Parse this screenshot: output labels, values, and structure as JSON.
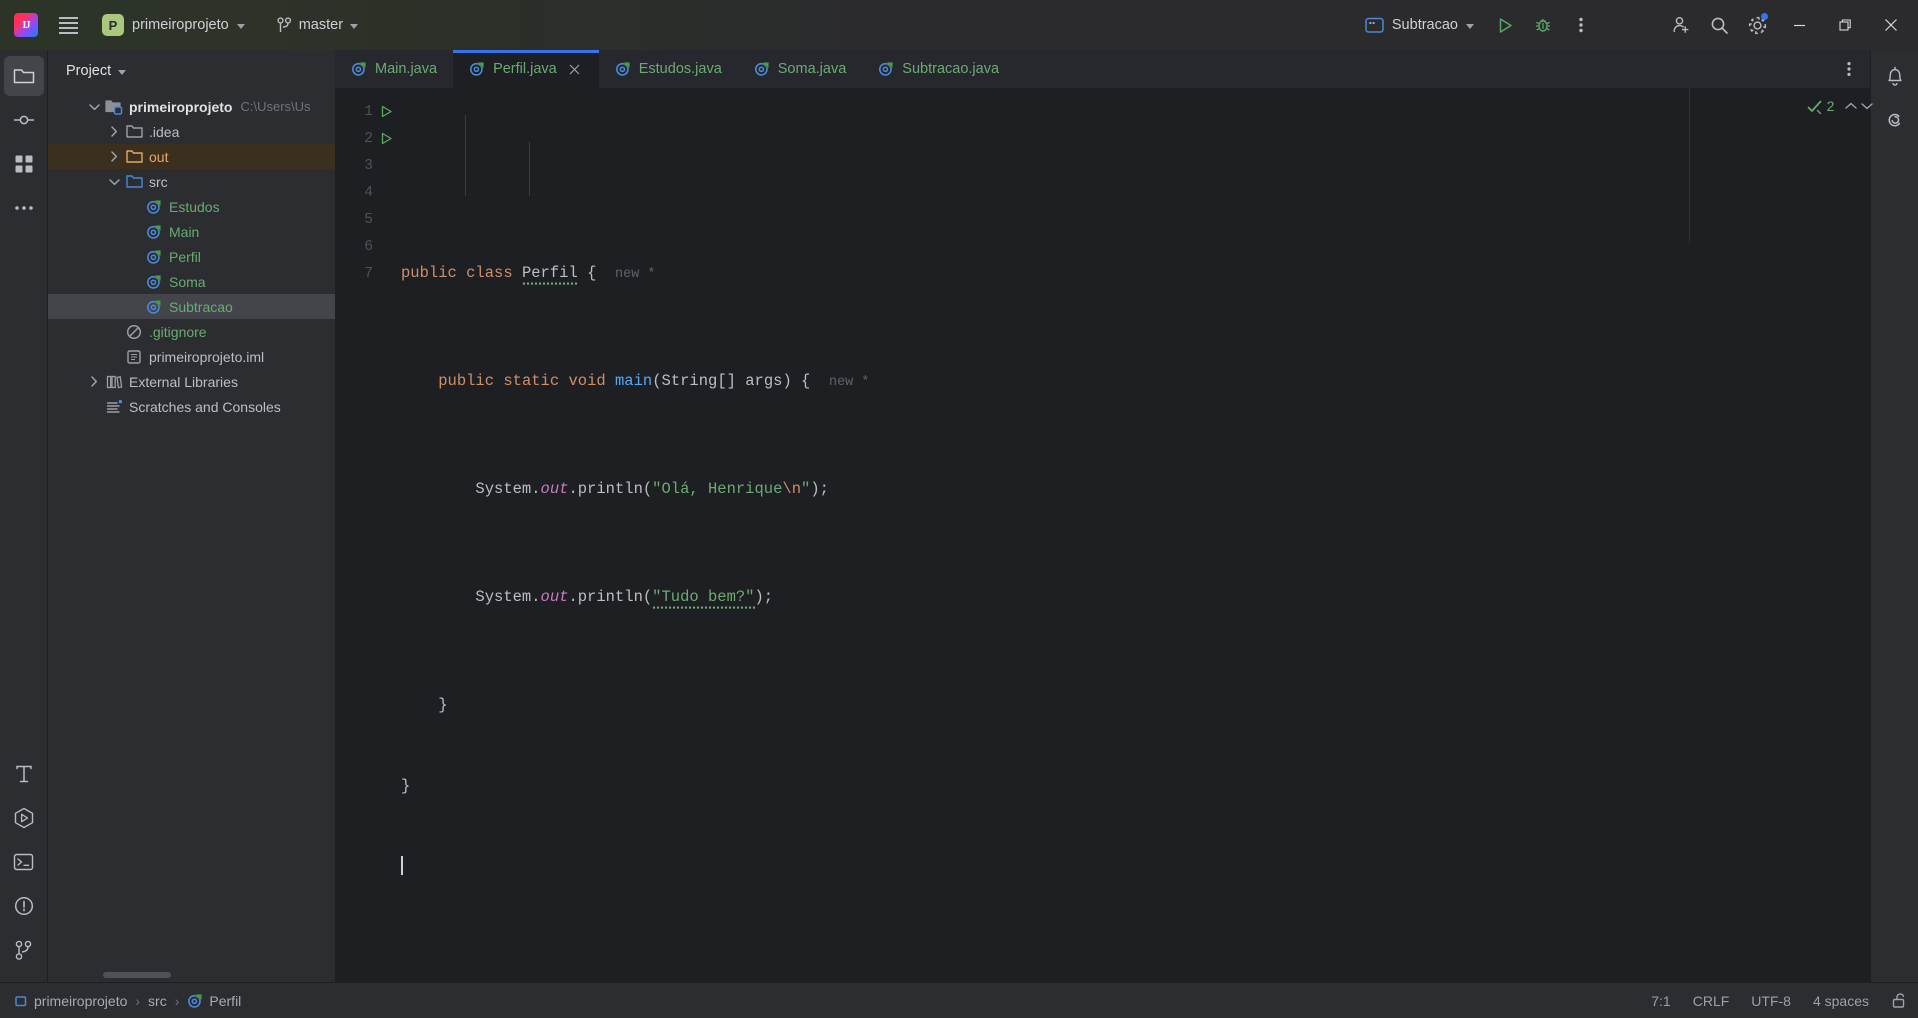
{
  "titlebar": {
    "logo_icon": "intellij-idea-logo",
    "logo_text": "IJ",
    "menu_icon": "hamburger-menu-icon",
    "project_badge": "P",
    "project_name": "primeiroprojeto",
    "vcs_icon": "git-branch-icon",
    "vcs_branch": "master",
    "run_config_icon": "run-configuration-icon",
    "run_config_name": "Subtracao",
    "run_icon": "run-play-icon",
    "debug_icon": "debug-bug-icon",
    "more_icon": "more-vertical-icon",
    "account_icon": "add-user-icon",
    "search_icon": "search-icon",
    "settings_icon": "gear-icon",
    "minimize_icon": "minimize-icon",
    "maximize_icon": "maximize-restore-icon",
    "close_icon": "close-icon"
  },
  "left_stripe": {
    "top_items": [
      {
        "name": "project-tool-window",
        "icon": "folder-icon",
        "active": true
      },
      {
        "name": "commit-tool-window",
        "icon": "commit-icon",
        "active": false
      },
      {
        "name": "structure-tool-window",
        "icon": "structure-icon",
        "active": false
      },
      {
        "name": "more-tool-windows",
        "icon": "more-horizontal-icon",
        "active": false
      }
    ],
    "bottom_items": [
      {
        "name": "ai-assistant-tool-window",
        "icon": "text-tool-icon"
      },
      {
        "name": "services-tool-window",
        "icon": "run-services-icon"
      },
      {
        "name": "terminal-tool-window",
        "icon": "terminal-icon"
      },
      {
        "name": "problems-tool-window",
        "icon": "problems-icon"
      },
      {
        "name": "version-control-tool-window",
        "icon": "git-icon"
      }
    ]
  },
  "right_stripe": {
    "items": [
      {
        "name": "notifications-tool-window",
        "icon": "bell-icon"
      },
      {
        "name": "ai-chat-tool-window",
        "icon": "ai-spiral-icon"
      }
    ]
  },
  "project_panel": {
    "title": "Project",
    "title_chevron_icon": "chevron-down-icon",
    "tree": [
      {
        "name": "primeiroprojeto",
        "suffix": "C:\\Users\\Us",
        "depth": 0,
        "icon": "module-folder-icon",
        "arrow": "expanded",
        "style": "white"
      },
      {
        "name": ".idea",
        "depth": 1,
        "icon": "folder-icon-gray",
        "arrow": "collapsed",
        "style": "plain"
      },
      {
        "name": "out",
        "depth": 1,
        "icon": "folder-icon-orange",
        "arrow": "collapsed",
        "style": "orange",
        "highlight": "warn"
      },
      {
        "name": "src",
        "depth": 1,
        "icon": "folder-icon-blue",
        "arrow": "expanded",
        "style": "plain"
      },
      {
        "name": "Estudos",
        "depth": 2,
        "icon": "java-class-icon",
        "arrow": "none",
        "style": "green"
      },
      {
        "name": "Main",
        "depth": 2,
        "icon": "java-class-icon",
        "arrow": "none",
        "style": "green"
      },
      {
        "name": "Perfil",
        "depth": 2,
        "icon": "java-class-icon",
        "arrow": "none",
        "style": "green"
      },
      {
        "name": "Soma",
        "depth": 2,
        "icon": "java-class-icon",
        "arrow": "none",
        "style": "green"
      },
      {
        "name": "Subtracao",
        "depth": 2,
        "icon": "java-class-icon",
        "arrow": "none",
        "style": "green",
        "highlight": "sel"
      },
      {
        "name": ".gitignore",
        "depth": 1,
        "icon": "gitignore-icon",
        "arrow": "none",
        "style": "green"
      },
      {
        "name": "primeiroprojeto.iml",
        "depth": 1,
        "icon": "iml-file-icon",
        "arrow": "none",
        "style": "plain"
      },
      {
        "name": "External Libraries",
        "depth": 0,
        "icon": "libraries-icon",
        "arrow": "collapsed",
        "style": "plain"
      },
      {
        "name": "Scratches and Consoles",
        "depth": 0,
        "icon": "scratches-icon",
        "arrow": "none",
        "style": "plain"
      }
    ]
  },
  "editor": {
    "tabs": [
      {
        "label": "Main.java",
        "icon": "java-class-icon",
        "active": false,
        "closable": false
      },
      {
        "label": "Perfil.java",
        "icon": "java-class-icon",
        "active": true,
        "closable": true
      },
      {
        "label": "Estudos.java",
        "icon": "java-class-icon",
        "active": false,
        "closable": false
      },
      {
        "label": "Soma.java",
        "icon": "java-class-icon",
        "active": false,
        "closable": false
      },
      {
        "label": "Subtracao.java",
        "icon": "java-class-icon",
        "active": false,
        "closable": false
      }
    ],
    "tab_close_icon": "close-icon",
    "tab_options_icon": "more-vertical-icon",
    "line_numbers": [
      "1",
      "2",
      "3",
      "4",
      "5",
      "6",
      "7"
    ],
    "gutter_run_icon": "run-gutter-icon",
    "inspection_count": "2",
    "inspection_icon": "inspections-ok-icon",
    "prev_problem_icon": "chevron-up-icon",
    "next_problem_icon": "chevron-down-icon",
    "code": {
      "line1": {
        "kw1": "public",
        "kw2": "class",
        "cls": "Perfil",
        "brace": "{",
        "hint": "new *"
      },
      "line2": {
        "kw1": "public",
        "kw2": "static",
        "kw3": "void",
        "mth": "main",
        "params": "(String[] args) {",
        "hint": "new *"
      },
      "line3": {
        "obj": "System.",
        "fld": "out",
        "call": ".println(",
        "str": "\"Olá, Henrique",
        "esc": "\\n",
        "strend": "\"",
        "tail": ");"
      },
      "line4": {
        "obj": "System.",
        "fld": "out",
        "call": ".println(",
        "str": "\"Tudo bem?\"",
        "tail": ");"
      },
      "line5": {
        "text": "}"
      },
      "line6": {
        "text": "}"
      }
    }
  },
  "statusbar": {
    "breadcrumbs": [
      {
        "label": "primeiroprojeto",
        "icon": "module-icon"
      },
      {
        "label": "src",
        "icon": "none"
      },
      {
        "label": "Perfil",
        "icon": "java-class-icon"
      }
    ],
    "separator": "›",
    "caret_position": "7:1",
    "line_separator": "CRLF",
    "encoding": "UTF-8",
    "indent": "4 spaces",
    "lock_icon": "unlocked-icon"
  },
  "colors": {
    "accent_blue": "#3574f0",
    "green_text": "#6aab73",
    "orange_text": "#e3a869",
    "keyword_orange": "#cf8e6d",
    "method_blue": "#56a8f5",
    "field_purple": "#c77dbb",
    "panel_bg": "#2b2d30",
    "editor_bg": "#1e1f22"
  }
}
